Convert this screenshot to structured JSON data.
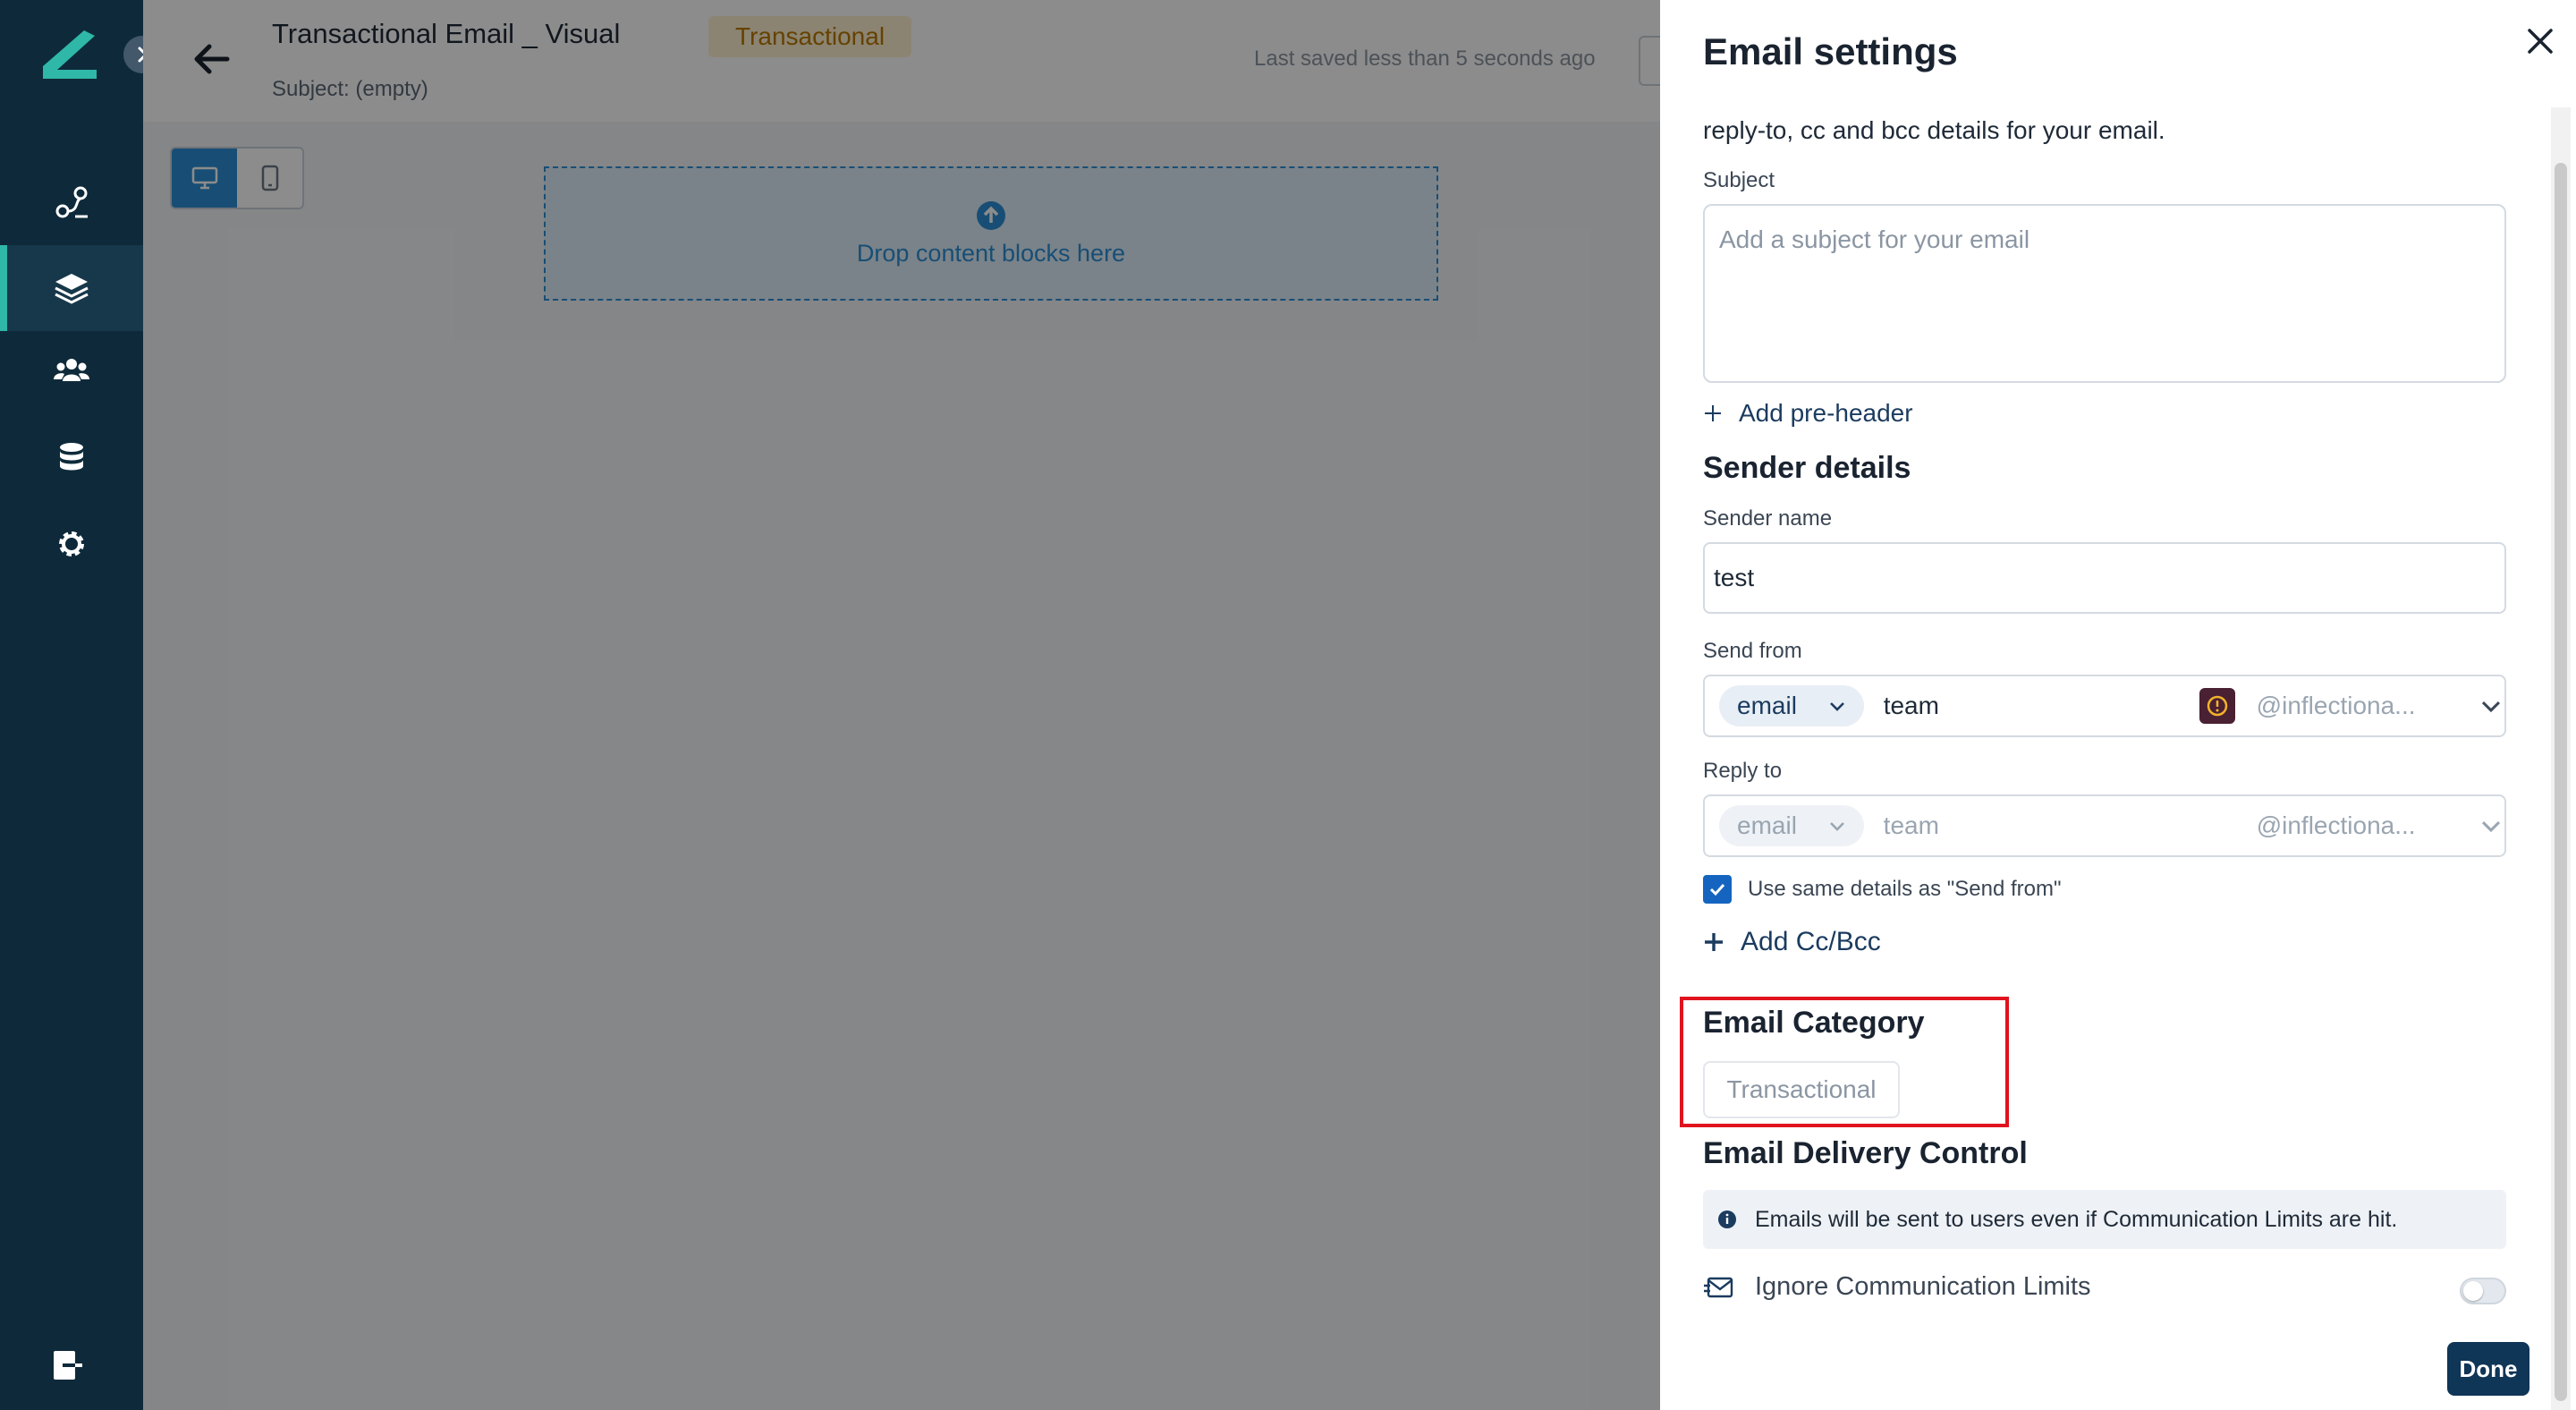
{
  "app": {
    "title": "Transactional Email _ Visual",
    "subject_line": "Subject: (empty)",
    "type_badge": "Transactional",
    "save_status": "Last saved less than 5 seconds ago"
  },
  "nav": {
    "items": [
      {
        "icon": "journeys-icon",
        "active": false
      },
      {
        "icon": "layers-icon",
        "active": true
      },
      {
        "icon": "users-icon",
        "active": false
      },
      {
        "icon": "database-icon",
        "active": false
      },
      {
        "icon": "gear-icon",
        "active": false
      }
    ],
    "bottom_icon": "logout-icon"
  },
  "canvas": {
    "view_modes": [
      "desktop",
      "mobile"
    ],
    "selected_view": "desktop",
    "dropzone_text": "Drop content blocks here"
  },
  "panel": {
    "title": "Email settings",
    "intro": "reply-to, cc and bcc details for your email.",
    "subject_label": "Subject",
    "subject_value": "",
    "subject_placeholder": "Add a subject for your email",
    "add_preheader": "Add pre-header",
    "sender_section": "Sender details",
    "sender_name_label": "Sender name",
    "sender_name_value": "test",
    "send_from_label": "Send from",
    "send_from": {
      "type": "email",
      "local": "team",
      "domain": "@inflectiona..."
    },
    "reply_to_label": "Reply to",
    "reply_to": {
      "type": "email",
      "local": "team",
      "domain": "@inflectiona..."
    },
    "same_details_label": "Use same details as \"Send from\"",
    "same_details_checked": true,
    "add_cc": "Add Cc/Bcc",
    "category_heading": "Email Category",
    "category_value": "Transactional",
    "delivery_heading": "Email Delivery Control",
    "delivery_info": "Emails will be sent to users even if Communication Limits are hit.",
    "ignore_limits_label": "Ignore Communication Limits",
    "ignore_limits_on": false,
    "done_label": "Done"
  },
  "colors": {
    "nav_bg": "#0e2a3a",
    "primary_blue": "#2d8fd5",
    "done_bg": "#0f3557",
    "highlight": "#e0131f",
    "badge_text": "#b97800"
  }
}
